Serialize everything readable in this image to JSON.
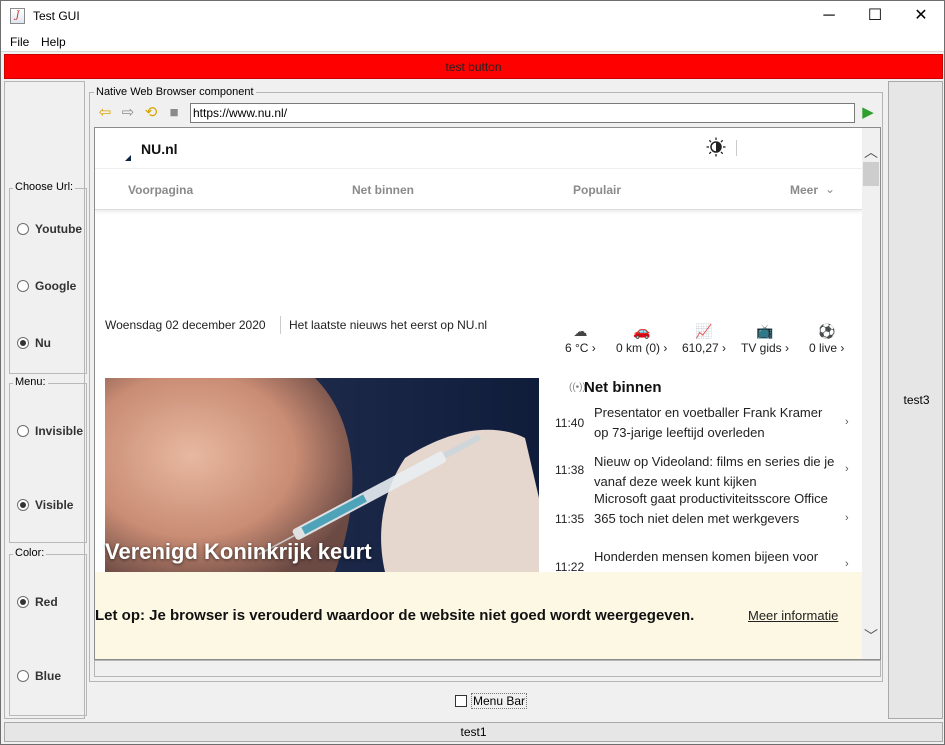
{
  "window": {
    "title": "Test GUI",
    "controls": {
      "minimize": "─",
      "maximize": "☐",
      "close": "✕"
    }
  },
  "menubar": {
    "items": [
      "File",
      "Help"
    ]
  },
  "test_button": {
    "label": "test button",
    "color": "#ff0000"
  },
  "left_panel": {
    "choose_url": {
      "legend": "Choose Url:",
      "options": [
        {
          "label": "Youtube",
          "selected": false
        },
        {
          "label": "Google",
          "selected": false
        },
        {
          "label": "Nu",
          "selected": true
        }
      ]
    },
    "menu": {
      "legend": "Menu:",
      "options": [
        {
          "label": "Invisible",
          "selected": false
        },
        {
          "label": "Visible",
          "selected": true
        }
      ]
    },
    "color": {
      "legend": "Color:",
      "options": [
        {
          "label": "Red",
          "selected": true
        },
        {
          "label": "Blue",
          "selected": false
        }
      ]
    }
  },
  "right_panel": {
    "label": "test3"
  },
  "browser": {
    "legend": "Native Web Browser component",
    "url": "https://www.nu.nl/",
    "icons": {
      "back": "back-arrow-icon",
      "forward": "forward-arrow-icon",
      "reload": "reload-icon",
      "stop": "stop-icon",
      "go": "go-icon"
    },
    "page": {
      "logo": "NU.nl",
      "nav": [
        "Voorpagina",
        "Net binnen",
        "Populair",
        "Meer"
      ],
      "date": "Woensdag 02 december 2020",
      "tagline": "Het laatste nieuws het eerst op NU.nl",
      "widgets": [
        {
          "icon": "cloud-icon",
          "label": "6 °C ›"
        },
        {
          "icon": "car-icon",
          "label": "0 km (0) ›"
        },
        {
          "icon": "chart-icon",
          "label": "610,27 ›"
        },
        {
          "icon": "tv-icon",
          "label": "TV gids ›"
        },
        {
          "icon": "soccer-icon",
          "label": "0 live ›"
        }
      ],
      "hero_headline": "Verenigd Koninkrijk keurt",
      "net_binnen_title": "Net binnen",
      "news": [
        {
          "time": "11:40",
          "text": "Presentator en voetballer Frank Kramer op 73-jarige leeftijd overleden"
        },
        {
          "time": "11:38",
          "text": "Nieuw op Videoland: films en series die je vanaf deze week kunt kijken"
        },
        {
          "time": "11:35",
          "text": "Microsoft gaat productiviteitsscore Office 365 toch niet delen met werkgevers"
        },
        {
          "time": "11:22",
          "text": "Honderden mensen komen bijeen voor"
        }
      ],
      "banner_text": "Let op: Je browser is verouderd waardoor de website niet goed wordt weergegeven.",
      "banner_link": "Meer informatie"
    }
  },
  "menu_bar_checkbox": {
    "label": "Menu Bar",
    "checked": false
  },
  "statusbar": {
    "label": "test1"
  }
}
